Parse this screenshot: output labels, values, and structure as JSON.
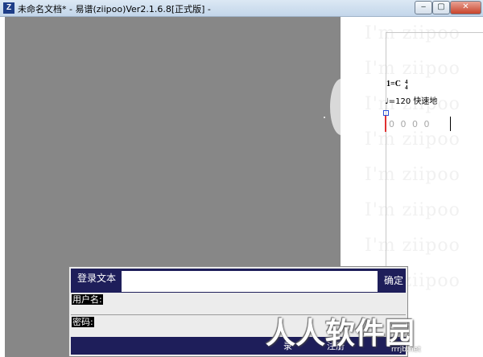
{
  "window": {
    "title": "未命名文档* - 易谱(ziipoo)Ver2.1.6.8[正式版]  -",
    "app_icon": "Z",
    "controls": {
      "minimize": "‒",
      "maximize": "▢",
      "close": "✕"
    }
  },
  "score": {
    "watermark_text": "I'm ziipoo",
    "watermark_rows": 8,
    "key": "1=C",
    "time_sig_top": "4",
    "time_sig_bottom": "4",
    "tempo": "♩=120 快速地",
    "notes": "0 0 0 0"
  },
  "login": {
    "title": "登录文本",
    "confirm": "确定",
    "username_label": "用户名:",
    "password_label": "密码:",
    "username_value": "",
    "password_value": "",
    "footer_login": "录",
    "footer_register": "注册"
  },
  "overlay": {
    "site_watermark": "人人软件园",
    "site_url": "rrrjb.net"
  },
  "colors": {
    "canvas": "#878787",
    "dialog_dark": "#1e1e5a",
    "bar_red": "#e03030"
  }
}
